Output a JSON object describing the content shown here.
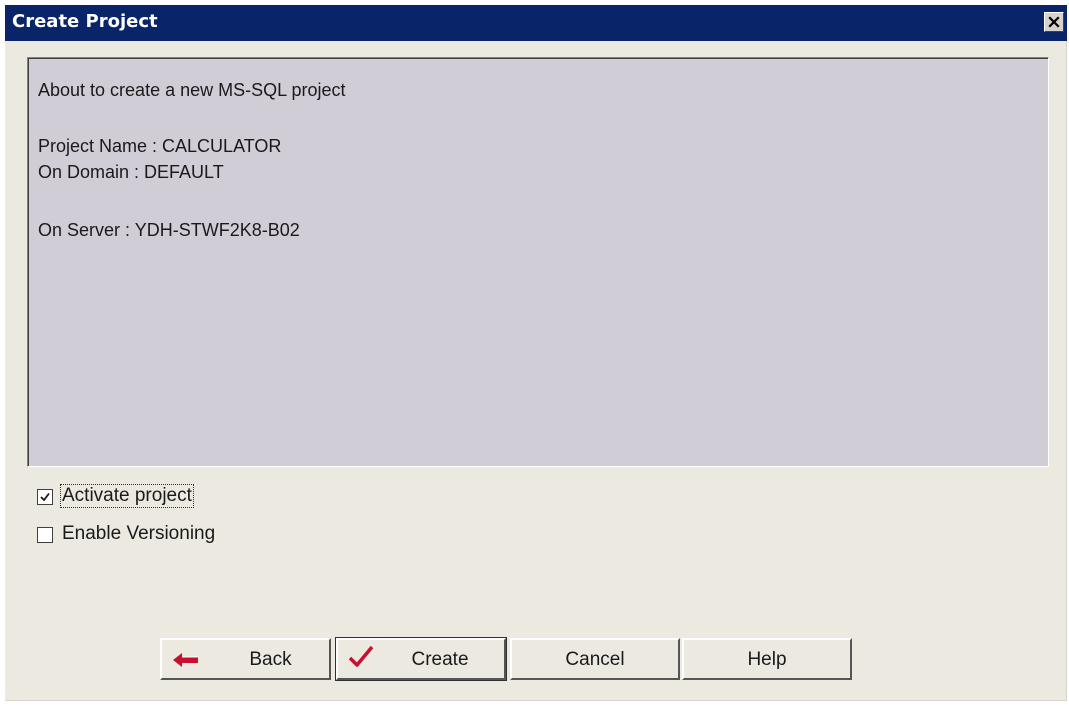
{
  "window": {
    "title": "Create Project",
    "close_icon": "close-icon"
  },
  "info": {
    "intro": "About to create a new MS-SQL project",
    "project_name": "Project Name : CALCULATOR",
    "domain": "On Domain : DEFAULT",
    "server": "On Server :  YDH-STWF2K8-B02"
  },
  "options": {
    "activate_label": "Activate project",
    "activate_checked": true,
    "versioning_label": "Enable Versioning",
    "versioning_checked": false
  },
  "buttons": {
    "back": {
      "label": "Back",
      "icon": "arrow-left-icon"
    },
    "create": {
      "label": "Create",
      "icon": "checkmark-icon"
    },
    "cancel": {
      "label": "Cancel"
    },
    "help": {
      "label": "Help"
    }
  },
  "colors": {
    "titlebar": "#0a246a",
    "panel": "#d1cdd6",
    "dialog": "#ece9e0",
    "accent_red": "#c8102e"
  }
}
